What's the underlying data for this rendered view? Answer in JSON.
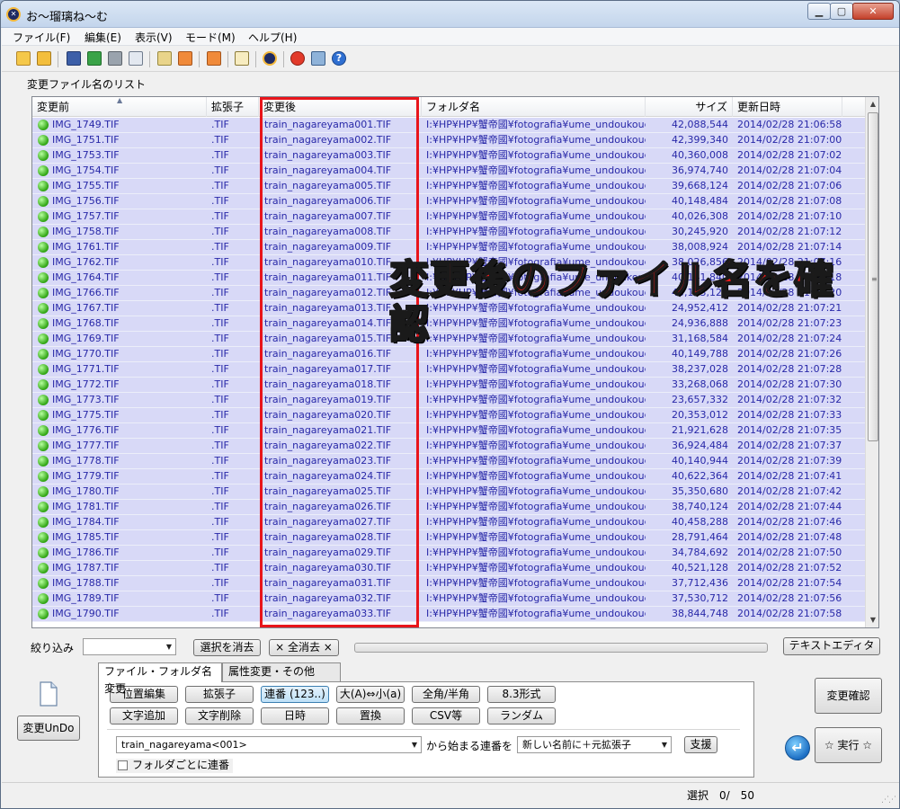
{
  "window": {
    "title": "お～瑠璃ね～む"
  },
  "menu": [
    "ファイル(F)",
    "編集(E)",
    "表示(V)",
    "モード(M)",
    "ヘルプ(H)"
  ],
  "toolbar_icons": [
    "open-folder-icon",
    "open-folder-alt-icon",
    "save-icon",
    "refresh-icon",
    "cut-icon",
    "copy-icon",
    "paste-icon",
    "move-up-icon",
    "move-down-icon",
    "export-icon",
    "app-logo-icon",
    "record-icon",
    "settings-icon",
    "help-icon"
  ],
  "group_label": "変更ファイル名のリスト",
  "columns": [
    "変更前",
    "拡張子",
    "変更後",
    "フォルダ名",
    "サイズ",
    "更新日時"
  ],
  "rows": [
    {
      "before": "IMG_1749.TIF",
      "ext": ".TIF",
      "after": "train_nagareyama001.TIF",
      "folder": "I:¥HP¥HP¥蟹帝國¥fotografia¥ume_undoukoue...",
      "size": "42,088,544",
      "date": "2014/02/28 21:06:58"
    },
    {
      "before": "IMG_1751.TIF",
      "ext": ".TIF",
      "after": "train_nagareyama002.TIF",
      "folder": "I:¥HP¥HP¥蟹帝國¥fotografia¥ume_undoukoue...",
      "size": "42,399,340",
      "date": "2014/02/28 21:07:00"
    },
    {
      "before": "IMG_1753.TIF",
      "ext": ".TIF",
      "after": "train_nagareyama003.TIF",
      "folder": "I:¥HP¥HP¥蟹帝國¥fotografia¥ume_undoukoue...",
      "size": "40,360,008",
      "date": "2014/02/28 21:07:02"
    },
    {
      "before": "IMG_1754.TIF",
      "ext": ".TIF",
      "after": "train_nagareyama004.TIF",
      "folder": "I:¥HP¥HP¥蟹帝國¥fotografia¥ume_undoukoue...",
      "size": "36,974,740",
      "date": "2014/02/28 21:07:04"
    },
    {
      "before": "IMG_1755.TIF",
      "ext": ".TIF",
      "after": "train_nagareyama005.TIF",
      "folder": "I:¥HP¥HP¥蟹帝國¥fotografia¥ume_undoukoue...",
      "size": "39,668,124",
      "date": "2014/02/28 21:07:06"
    },
    {
      "before": "IMG_1756.TIF",
      "ext": ".TIF",
      "after": "train_nagareyama006.TIF",
      "folder": "I:¥HP¥HP¥蟹帝國¥fotografia¥ume_undoukoue...",
      "size": "40,148,484",
      "date": "2014/02/28 21:07:08"
    },
    {
      "before": "IMG_1757.TIF",
      "ext": ".TIF",
      "after": "train_nagareyama007.TIF",
      "folder": "I:¥HP¥HP¥蟹帝國¥fotografia¥ume_undoukoue...",
      "size": "40,026,308",
      "date": "2014/02/28 21:07:10"
    },
    {
      "before": "IMG_1758.TIF",
      "ext": ".TIF",
      "after": "train_nagareyama008.TIF",
      "folder": "I:¥HP¥HP¥蟹帝國¥fotografia¥ume_undoukoue...",
      "size": "30,245,920",
      "date": "2014/02/28 21:07:12"
    },
    {
      "before": "IMG_1761.TIF",
      "ext": ".TIF",
      "after": "train_nagareyama009.TIF",
      "folder": "I:¥HP¥HP¥蟹帝國¥fotografia¥ume_undoukoue...",
      "size": "38,008,924",
      "date": "2014/02/28 21:07:14"
    },
    {
      "before": "IMG_1762.TIF",
      "ext": ".TIF",
      "after": "train_nagareyama010.TIF",
      "folder": "I:¥HP¥HP¥蟹帝國¥fotografia¥ume_undoukoue...",
      "size": "38,026,856",
      "date": "2014/02/28 21:07:16"
    },
    {
      "before": "IMG_1764.TIF",
      "ext": ".TIF",
      "after": "train_nagareyama011.TIF",
      "folder": "I:¥HP¥HP¥蟹帝國¥fotografia¥ume_undoukoue...",
      "size": "40,141,840",
      "date": "2014/02/28 21:07:18"
    },
    {
      "before": "IMG_1766.TIF",
      "ext": ".TIF",
      "after": "train_nagareyama012.TIF",
      "folder": "I:¥HP¥HP¥蟹帝國¥fotografia¥ume_undoukoue...",
      "size": "40,143,128",
      "date": "2014/02/28 21:07:20"
    },
    {
      "before": "IMG_1767.TIF",
      "ext": ".TIF",
      "after": "train_nagareyama013.TIF",
      "folder": "I:¥HP¥HP¥蟹帝國¥fotografia¥ume_undoukoue...",
      "size": "24,952,412",
      "date": "2014/02/28 21:07:21"
    },
    {
      "before": "IMG_1768.TIF",
      "ext": ".TIF",
      "after": "train_nagareyama014.TIF",
      "folder": "I:¥HP¥HP¥蟹帝國¥fotografia¥ume_undoukoue...",
      "size": "24,936,888",
      "date": "2014/02/28 21:07:23"
    },
    {
      "before": "IMG_1769.TIF",
      "ext": ".TIF",
      "after": "train_nagareyama015.TIF",
      "folder": "I:¥HP¥HP¥蟹帝國¥fotografia¥ume_undoukoue...",
      "size": "31,168,584",
      "date": "2014/02/28 21:07:24"
    },
    {
      "before": "IMG_1770.TIF",
      "ext": ".TIF",
      "after": "train_nagareyama016.TIF",
      "folder": "I:¥HP¥HP¥蟹帝國¥fotografia¥ume_undoukoue...",
      "size": "40,149,788",
      "date": "2014/02/28 21:07:26"
    },
    {
      "before": "IMG_1771.TIF",
      "ext": ".TIF",
      "after": "train_nagareyama017.TIF",
      "folder": "I:¥HP¥HP¥蟹帝國¥fotografia¥ume_undoukoue...",
      "size": "38,237,028",
      "date": "2014/02/28 21:07:28"
    },
    {
      "before": "IMG_1772.TIF",
      "ext": ".TIF",
      "after": "train_nagareyama018.TIF",
      "folder": "I:¥HP¥HP¥蟹帝國¥fotografia¥ume_undoukoue...",
      "size": "33,268,068",
      "date": "2014/02/28 21:07:30"
    },
    {
      "before": "IMG_1773.TIF",
      "ext": ".TIF",
      "after": "train_nagareyama019.TIF",
      "folder": "I:¥HP¥HP¥蟹帝國¥fotografia¥ume_undoukoue...",
      "size": "23,657,332",
      "date": "2014/02/28 21:07:32"
    },
    {
      "before": "IMG_1775.TIF",
      "ext": ".TIF",
      "after": "train_nagareyama020.TIF",
      "folder": "I:¥HP¥HP¥蟹帝國¥fotografia¥ume_undoukoue...",
      "size": "20,353,012",
      "date": "2014/02/28 21:07:33"
    },
    {
      "before": "IMG_1776.TIF",
      "ext": ".TIF",
      "after": "train_nagareyama021.TIF",
      "folder": "I:¥HP¥HP¥蟹帝國¥fotografia¥ume_undoukoue...",
      "size": "21,921,628",
      "date": "2014/02/28 21:07:35"
    },
    {
      "before": "IMG_1777.TIF",
      "ext": ".TIF",
      "after": "train_nagareyama022.TIF",
      "folder": "I:¥HP¥HP¥蟹帝國¥fotografia¥ume_undoukoue...",
      "size": "36,924,484",
      "date": "2014/02/28 21:07:37"
    },
    {
      "before": "IMG_1778.TIF",
      "ext": ".TIF",
      "after": "train_nagareyama023.TIF",
      "folder": "I:¥HP¥HP¥蟹帝國¥fotografia¥ume_undoukoue...",
      "size": "40,140,944",
      "date": "2014/02/28 21:07:39"
    },
    {
      "before": "IMG_1779.TIF",
      "ext": ".TIF",
      "after": "train_nagareyama024.TIF",
      "folder": "I:¥HP¥HP¥蟹帝國¥fotografia¥ume_undoukoue...",
      "size": "40,622,364",
      "date": "2014/02/28 21:07:41"
    },
    {
      "before": "IMG_1780.TIF",
      "ext": ".TIF",
      "after": "train_nagareyama025.TIF",
      "folder": "I:¥HP¥HP¥蟹帝國¥fotografia¥ume_undoukoue...",
      "size": "35,350,680",
      "date": "2014/02/28 21:07:42"
    },
    {
      "before": "IMG_1781.TIF",
      "ext": ".TIF",
      "after": "train_nagareyama026.TIF",
      "folder": "I:¥HP¥HP¥蟹帝國¥fotografia¥ume_undoukoue...",
      "size": "38,740,124",
      "date": "2014/02/28 21:07:44"
    },
    {
      "before": "IMG_1784.TIF",
      "ext": ".TIF",
      "after": "train_nagareyama027.TIF",
      "folder": "I:¥HP¥HP¥蟹帝國¥fotografia¥ume_undoukoue...",
      "size": "40,458,288",
      "date": "2014/02/28 21:07:46"
    },
    {
      "before": "IMG_1785.TIF",
      "ext": ".TIF",
      "after": "train_nagareyama028.TIF",
      "folder": "I:¥HP¥HP¥蟹帝國¥fotografia¥ume_undoukoue...",
      "size": "28,791,464",
      "date": "2014/02/28 21:07:48"
    },
    {
      "before": "IMG_1786.TIF",
      "ext": ".TIF",
      "after": "train_nagareyama029.TIF",
      "folder": "I:¥HP¥HP¥蟹帝國¥fotografia¥ume_undoukoue...",
      "size": "34,784,692",
      "date": "2014/02/28 21:07:50"
    },
    {
      "before": "IMG_1787.TIF",
      "ext": ".TIF",
      "after": "train_nagareyama030.TIF",
      "folder": "I:¥HP¥HP¥蟹帝國¥fotografia¥ume_undoukoue...",
      "size": "40,521,128",
      "date": "2014/02/28 21:07:52"
    },
    {
      "before": "IMG_1788.TIF",
      "ext": ".TIF",
      "after": "train_nagareyama031.TIF",
      "folder": "I:¥HP¥HP¥蟹帝國¥fotografia¥ume_undoukoue...",
      "size": "37,712,436",
      "date": "2014/02/28 21:07:54"
    },
    {
      "before": "IMG_1789.TIF",
      "ext": ".TIF",
      "after": "train_nagareyama032.TIF",
      "folder": "I:¥HP¥HP¥蟹帝國¥fotografia¥ume_undoukoue...",
      "size": "37,530,712",
      "date": "2014/02/28 21:07:56"
    },
    {
      "before": "IMG_1790.TIF",
      "ext": ".TIF",
      "after": "train_nagareyama033.TIF",
      "folder": "I:¥HP¥HP¥蟹帝國¥fotografia¥ume_undoukoue...",
      "size": "38,844,748",
      "date": "2014/02/28 21:07:58"
    }
  ],
  "annotation": {
    "text": "変更後のファイル名を確認",
    "color": "#ff1a1a"
  },
  "filter": {
    "label": "絞り込み",
    "value": "",
    "clear_selection_label": "選択を消去",
    "clear_all_label": "× 全消去 ×",
    "text_editor_label": "テキストエディタ"
  },
  "tabs": [
    "ファイル・フォルダ名変更",
    "属性変更・その他"
  ],
  "ops_row1": [
    "位置編集",
    "拡張子",
    "連番 (123..)",
    "大(A)⇔小(a)",
    "全角/半角",
    "8.3形式"
  ],
  "ops_row2": [
    "文字追加",
    "文字削除",
    "日時",
    "置換",
    "CSV等",
    "ランダム"
  ],
  "sequence": {
    "pattern": "train_nagareyama<001>",
    "suffix": "から始まる連番を",
    "mode": "新しい名前に＋元拡張子",
    "help_label": "支援",
    "checkbox_label": "フォルダごとに連番"
  },
  "undo_label": "変更UnDo",
  "confirm_label": "変更確認",
  "run_label": "☆ 実行 ☆",
  "status": "選択　0/　50",
  "colors": {
    "row_bg": "#d8d9f7",
    "row_text": "#2828a8",
    "highlight": "#e8151b"
  }
}
